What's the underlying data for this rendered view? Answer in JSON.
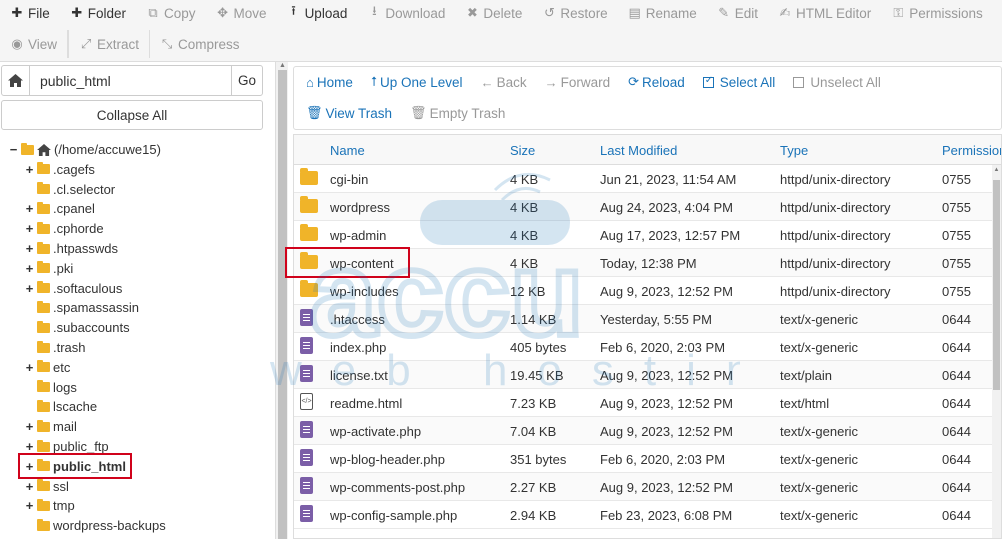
{
  "toolbar": {
    "row1": [
      {
        "label": "File",
        "icon": "plus-icon",
        "glyph": "✚",
        "disabled": false
      },
      {
        "label": "Folder",
        "icon": "plus-icon",
        "glyph": "✚",
        "disabled": false
      },
      {
        "label": "Copy",
        "icon": "copy-icon",
        "glyph": "⧉",
        "disabled": true
      },
      {
        "label": "Move",
        "icon": "move-icon",
        "glyph": "✥",
        "disabled": true
      },
      {
        "label": "Upload",
        "icon": "upload-icon",
        "glyph": "⭱",
        "disabled": false
      },
      {
        "label": "Download",
        "icon": "download-icon",
        "glyph": "⭳",
        "disabled": true
      },
      {
        "label": "Delete",
        "icon": "delete-icon",
        "glyph": "✖",
        "disabled": true
      },
      {
        "label": "Restore",
        "icon": "restore-icon",
        "glyph": "↺",
        "disabled": true
      },
      {
        "label": "Rename",
        "icon": "rename-icon",
        "glyph": "▤",
        "disabled": true
      },
      {
        "label": "Edit",
        "icon": "edit-icon",
        "glyph": "✎",
        "disabled": true
      },
      {
        "label": "HTML Editor",
        "icon": "html-editor-icon",
        "glyph": "✍",
        "disabled": true
      },
      {
        "label": "Permissions",
        "icon": "key-icon",
        "glyph": "⚿",
        "disabled": true
      }
    ],
    "row2": [
      {
        "label": "View",
        "icon": "eye-icon",
        "glyph": "◉",
        "disabled": true
      },
      {
        "label": "Extract",
        "icon": "extract-icon",
        "glyph": "⤢",
        "disabled": true
      },
      {
        "label": "Compress",
        "icon": "compress-icon",
        "glyph": "⤡",
        "disabled": true
      }
    ]
  },
  "left": {
    "path_value": "public_html",
    "go_label": "Go",
    "collapse_label": "Collapse All",
    "root_label": "(/home/accuwe15)",
    "tree": [
      {
        "label": ".cagefs",
        "toggle": "+"
      },
      {
        "label": ".cl.selector",
        "toggle": ""
      },
      {
        "label": ".cpanel",
        "toggle": "+"
      },
      {
        "label": ".cphorde",
        "toggle": "+"
      },
      {
        "label": ".htpasswds",
        "toggle": "+"
      },
      {
        "label": ".pki",
        "toggle": "+"
      },
      {
        "label": ".softaculous",
        "toggle": "+"
      },
      {
        "label": ".spamassassin",
        "toggle": ""
      },
      {
        "label": ".subaccounts",
        "toggle": ""
      },
      {
        "label": ".trash",
        "toggle": ""
      },
      {
        "label": "etc",
        "toggle": "+"
      },
      {
        "label": "logs",
        "toggle": ""
      },
      {
        "label": "lscache",
        "toggle": ""
      },
      {
        "label": "mail",
        "toggle": "+"
      },
      {
        "label": "public_ftp",
        "toggle": "+"
      },
      {
        "label": "public_html",
        "toggle": "+",
        "selected": true
      },
      {
        "label": "ssl",
        "toggle": "+"
      },
      {
        "label": "tmp",
        "toggle": "+"
      },
      {
        "label": "wordpress-backups",
        "toggle": ""
      }
    ]
  },
  "actions": {
    "row1": [
      {
        "label": "Home",
        "icon": "home-icon",
        "glyph": "⌂",
        "disabled": false
      },
      {
        "label": "Up One Level",
        "icon": "up-arrow-icon",
        "glyph": "⭡",
        "disabled": false
      },
      {
        "label": "Back",
        "icon": "back-arrow-icon",
        "glyph": "←",
        "disabled": true
      },
      {
        "label": "Forward",
        "icon": "forward-arrow-icon",
        "glyph": "→",
        "disabled": true
      },
      {
        "label": "Reload",
        "icon": "reload-icon",
        "glyph": "⟳",
        "disabled": false
      },
      {
        "label": "Select All",
        "icon": "checkbox-checked-icon",
        "glyph": "",
        "checkbox": "checked",
        "disabled": false
      },
      {
        "label": "Unselect All",
        "icon": "checkbox-empty-icon",
        "glyph": "",
        "checkbox": "empty",
        "disabled": true
      }
    ],
    "row2": [
      {
        "label": "View Trash",
        "icon": "trash-icon",
        "glyph": "🗑",
        "disabled": false
      },
      {
        "label": "Empty Trash",
        "icon": "trash-icon",
        "glyph": "🗑",
        "disabled": true
      }
    ]
  },
  "table": {
    "headers": {
      "name": "Name",
      "size": "Size",
      "modified": "Last Modified",
      "type": "Type",
      "perm": "Permission"
    },
    "rows": [
      {
        "name": "cgi-bin",
        "size": "4 KB",
        "modified": "Jun 21, 2023, 11:54 AM",
        "type": "httpd/unix-directory",
        "perm": "0755",
        "kind": "folder"
      },
      {
        "name": "wordpress",
        "size": "4 KB",
        "modified": "Aug 24, 2023, 4:04 PM",
        "type": "httpd/unix-directory",
        "perm": "0755",
        "kind": "folder"
      },
      {
        "name": "wp-admin",
        "size": "4 KB",
        "modified": "Aug 17, 2023, 12:57 PM",
        "type": "httpd/unix-directory",
        "perm": "0755",
        "kind": "folder"
      },
      {
        "name": "wp-content",
        "size": "4 KB",
        "modified": "Today, 12:38 PM",
        "type": "httpd/unix-directory",
        "perm": "0755",
        "kind": "folder",
        "highlight": true
      },
      {
        "name": "wp-includes",
        "size": "12 KB",
        "modified": "Aug 9, 2023, 12:52 PM",
        "type": "httpd/unix-directory",
        "perm": "0755",
        "kind": "folder"
      },
      {
        "name": ".htaccess",
        "size": "1.14 KB",
        "modified": "Yesterday, 5:55 PM",
        "type": "text/x-generic",
        "perm": "0644",
        "kind": "doc"
      },
      {
        "name": "index.php",
        "size": "405 bytes",
        "modified": "Feb 6, 2020, 2:03 PM",
        "type": "text/x-generic",
        "perm": "0644",
        "kind": "doc"
      },
      {
        "name": "license.txt",
        "size": "19.45 KB",
        "modified": "Aug 9, 2023, 12:52 PM",
        "type": "text/plain",
        "perm": "0644",
        "kind": "doc"
      },
      {
        "name": "readme.html",
        "size": "7.23 KB",
        "modified": "Aug 9, 2023, 12:52 PM",
        "type": "text/html",
        "perm": "0644",
        "kind": "code"
      },
      {
        "name": "wp-activate.php",
        "size": "7.04 KB",
        "modified": "Aug 9, 2023, 12:52 PM",
        "type": "text/x-generic",
        "perm": "0644",
        "kind": "doc"
      },
      {
        "name": "wp-blog-header.php",
        "size": "351 bytes",
        "modified": "Feb 6, 2020, 2:03 PM",
        "type": "text/x-generic",
        "perm": "0644",
        "kind": "doc"
      },
      {
        "name": "wp-comments-post.php",
        "size": "2.27 KB",
        "modified": "Aug 9, 2023, 12:52 PM",
        "type": "text/x-generic",
        "perm": "0644",
        "kind": "doc"
      },
      {
        "name": "wp-config-sample.php",
        "size": "2.94 KB",
        "modified": "Feb 23, 2023, 6:08 PM",
        "type": "text/x-generic",
        "perm": "0644",
        "kind": "doc"
      }
    ]
  },
  "watermark": {
    "line1": "accu",
    "line2": "web hosting"
  },
  "colors": {
    "accent": "#1a73b8",
    "folder": "#f0b429",
    "doc": "#7b5ea7",
    "highlight": "#d0021b"
  }
}
